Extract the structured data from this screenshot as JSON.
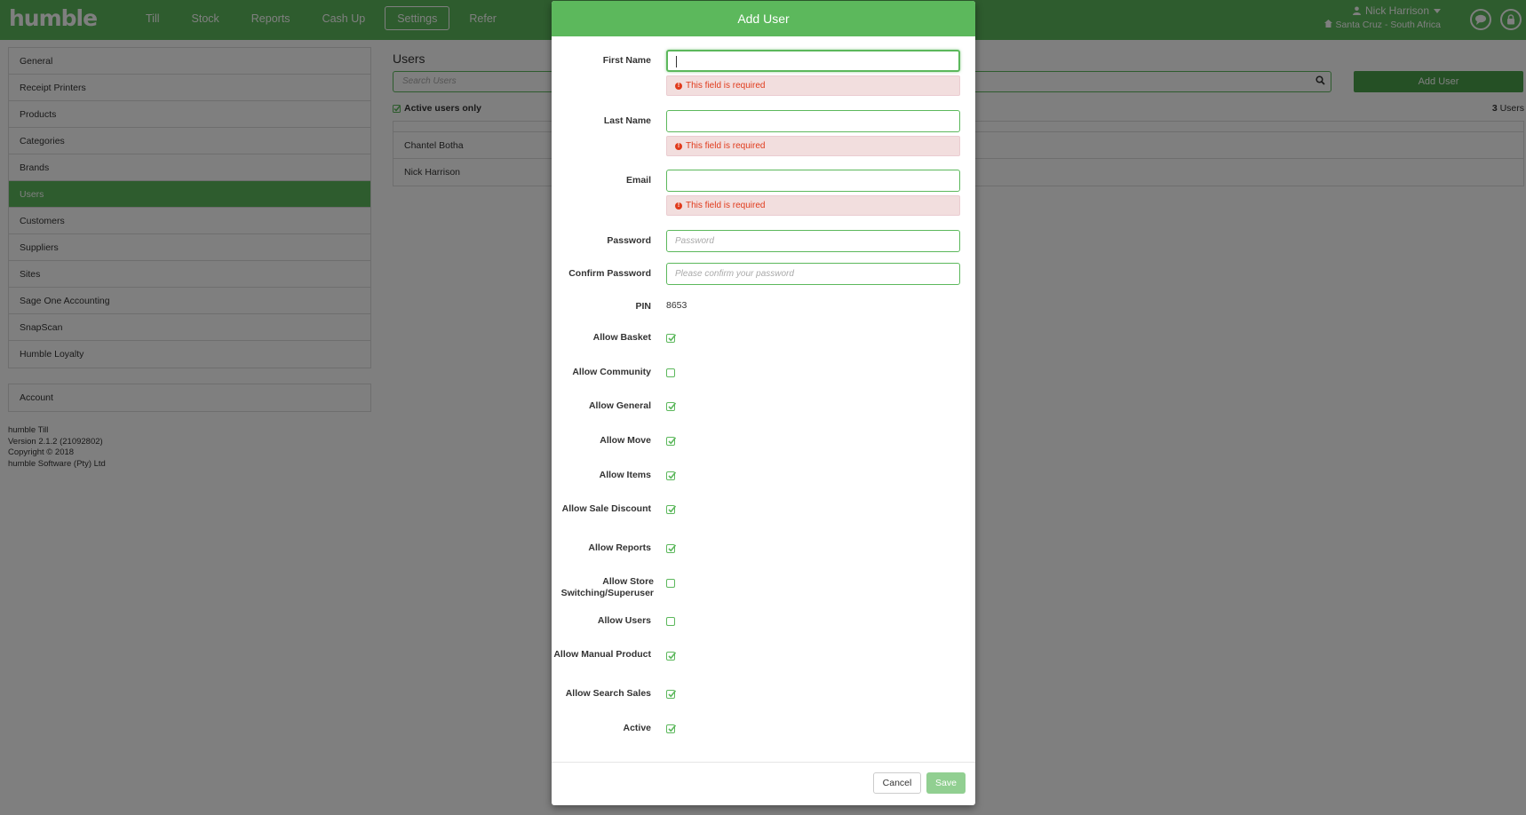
{
  "colors": {
    "brand_green": "#5cb85c",
    "dark_green": "#4aa14a",
    "error_red": "#e03b1c",
    "error_bg": "#f2dede"
  },
  "topbar": {
    "logo": "humble",
    "nav": [
      {
        "label": "Till",
        "active": false
      },
      {
        "label": "Stock",
        "active": false
      },
      {
        "label": "Reports",
        "active": false
      },
      {
        "label": "Cash Up",
        "active": false
      },
      {
        "label": "Settings",
        "active": true
      },
      {
        "label": "Refer",
        "active": false
      }
    ],
    "user_name": "Nick Harrison",
    "site": "Santa Cruz - South Africa",
    "icons": {
      "user": "user-icon",
      "caret": "caret-down-icon",
      "home": "home-icon",
      "chat": "chat-icon",
      "lock": "lock-icon"
    }
  },
  "sidebar": {
    "items": [
      {
        "label": "General",
        "active": false
      },
      {
        "label": "Receipt Printers",
        "active": false
      },
      {
        "label": "Products",
        "active": false
      },
      {
        "label": "Categories",
        "active": false
      },
      {
        "label": "Brands",
        "active": false
      },
      {
        "label": "Users",
        "active": true
      },
      {
        "label": "Customers",
        "active": false
      },
      {
        "label": "Suppliers",
        "active": false
      },
      {
        "label": "Sites",
        "active": false
      },
      {
        "label": "Sage One Accounting",
        "active": false
      },
      {
        "label": "SnapScan",
        "active": false
      },
      {
        "label": "Humble Loyalty",
        "active": false
      }
    ],
    "account": "Account",
    "version_lines": [
      "humble Till",
      "Version 2.1.2 (21092802)",
      "Copyright © 2018",
      "humble Software (Pty) Ltd"
    ]
  },
  "main": {
    "title": "Users",
    "search_placeholder": "Search Users",
    "add_user_label": "Add User",
    "active_only_label": "Active users only",
    "active_only_checked": true,
    "count": "3",
    "count_label": "Users",
    "users": [
      "Chantel Botha",
      "Nick Harrison"
    ]
  },
  "modal": {
    "title": "Add User",
    "fields": {
      "first_name": {
        "label": "First Name",
        "value": "",
        "error": "This field is required"
      },
      "last_name": {
        "label": "Last Name",
        "value": "",
        "error": "This field is required"
      },
      "email": {
        "label": "Email",
        "value": "",
        "error": "This field is required"
      },
      "password": {
        "label": "Password",
        "placeholder": "Password"
      },
      "confirm_password": {
        "label": "Confirm Password",
        "placeholder": "Please confirm your password"
      },
      "pin": {
        "label": "PIN",
        "value": "8653"
      }
    },
    "permissions": [
      {
        "label": "Allow Basket",
        "checked": true
      },
      {
        "label": "Allow Community",
        "checked": false
      },
      {
        "label": "Allow General",
        "checked": true
      },
      {
        "label": "Allow Move",
        "checked": true
      },
      {
        "label": "Allow Items",
        "checked": true
      },
      {
        "label": "Allow Sale Discount",
        "checked": true
      },
      {
        "label": "Allow Reports",
        "checked": true
      },
      {
        "label": "Allow Store Switching/Superuser",
        "checked": false
      },
      {
        "label": "Allow Users",
        "checked": false
      },
      {
        "label": "Allow Manual Product",
        "checked": true
      },
      {
        "label": "Allow Search Sales",
        "checked": true
      },
      {
        "label": "Active",
        "checked": true
      }
    ],
    "cancel_label": "Cancel",
    "save_label": "Save"
  }
}
